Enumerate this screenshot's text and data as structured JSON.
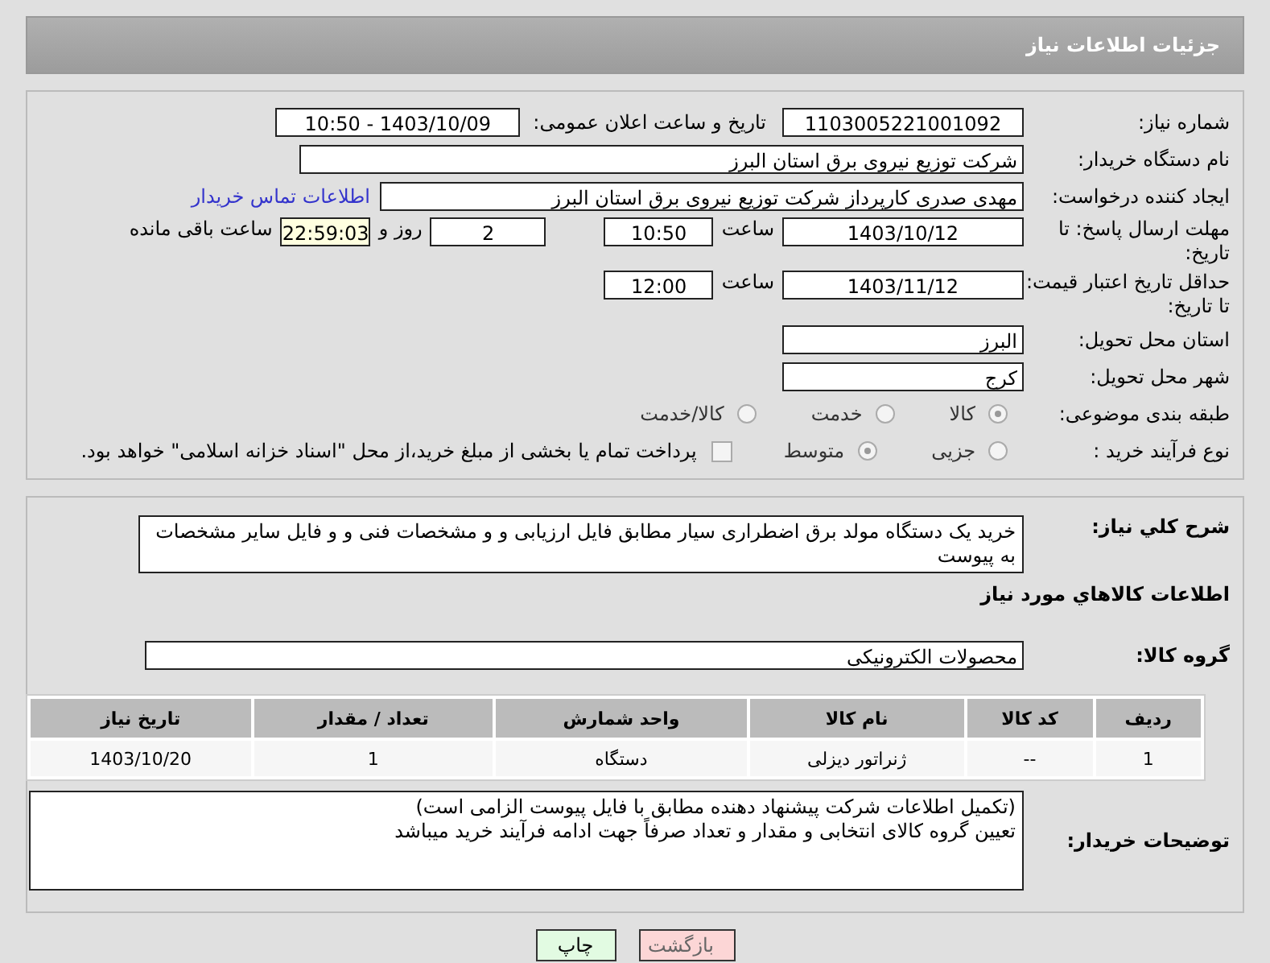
{
  "header": {
    "title": "جزئیات اطلاعات نیاز"
  },
  "fields": {
    "need_number": {
      "label": "شماره نیاز:",
      "value": "1103005221001092"
    },
    "announce": {
      "label": "تاریخ و ساعت اعلان عمومی:",
      "value": "1403/10/09 - 10:50"
    },
    "buyer": {
      "label": "نام دستگاه خریدار:",
      "value": "شرکت توزیع نیروی برق استان البرز"
    },
    "creator": {
      "label": "ایجاد کننده درخواست:",
      "value": "مهدی صدری کارپرداز شرکت توزیع نیروی برق استان البرز",
      "link": "اطلاعات تماس خریدار"
    },
    "deadline": {
      "label": "مهلت ارسال پاسخ: تا تاریخ:",
      "date": "1403/10/12",
      "time_label": "ساعت",
      "time": "10:50",
      "days": "2",
      "days_label": "روز و",
      "remaining": "22:59:03",
      "remaining_label": "ساعت باقی مانده"
    },
    "validity": {
      "label": "حداقل تاریخ اعتبار قیمت: تا تاریخ:",
      "date": "1403/11/12",
      "time_label": "ساعت",
      "time": "12:00"
    },
    "province": {
      "label": "استان محل تحویل:",
      "value": "البرز"
    },
    "city": {
      "label": "شهر محل تحویل:",
      "value": "کرج"
    }
  },
  "category": {
    "label": "طبقه بندی موضوعی:",
    "options": [
      {
        "label": "کالا",
        "selected": true
      },
      {
        "label": "خدمت",
        "selected": false
      },
      {
        "label": "کالا/خدمت",
        "selected": false
      }
    ]
  },
  "process": {
    "label": "نوع فرآیند خرید :",
    "options": [
      {
        "label": "جزیی",
        "selected": false
      },
      {
        "label": "متوسط",
        "selected": true
      }
    ],
    "treasury": {
      "checked": false,
      "label": "پرداخت تمام یا بخشی از مبلغ خرید،از محل \"اسناد خزانه اسلامی\" خواهد بود."
    }
  },
  "description": {
    "label": "شرح کلي نياز:",
    "value": "خرید یک دستگاه مولد برق اضطراری سیار مطابق فایل ارزیابی و و مشخصات فنی و و فایل سایر مشخصات به پیوست"
  },
  "goods_heading": "اطلاعات کالاهاي مورد نياز",
  "goods_group": {
    "label": "گروه کالا:",
    "value": "محصولات الکترونیکی"
  },
  "table": {
    "columns": [
      "ردیف",
      "کد کالا",
      "نام کالا",
      "واحد شمارش",
      "تعداد / مقدار",
      "تاریخ نیاز"
    ],
    "rows": [
      [
        "1",
        "--",
        "ژنراتور دیزلی",
        "دستگاه",
        "1",
        "1403/10/20"
      ]
    ]
  },
  "buyer_notes": {
    "label": "توضیحات خریدار:",
    "lines": [
      "(تکمیل اطلاعات شرکت پیشنهاد دهنده مطابق با فایل پیوست الزامی است)",
      "تعیین گروه کالای انتخابی و مقدار و تعداد صرفاً جهت ادامه فرآیند خرید میباشد"
    ]
  },
  "buttons": [
    {
      "label": "بازگشت",
      "kind": "back"
    },
    {
      "label": "چاپ",
      "kind": "print"
    }
  ]
}
